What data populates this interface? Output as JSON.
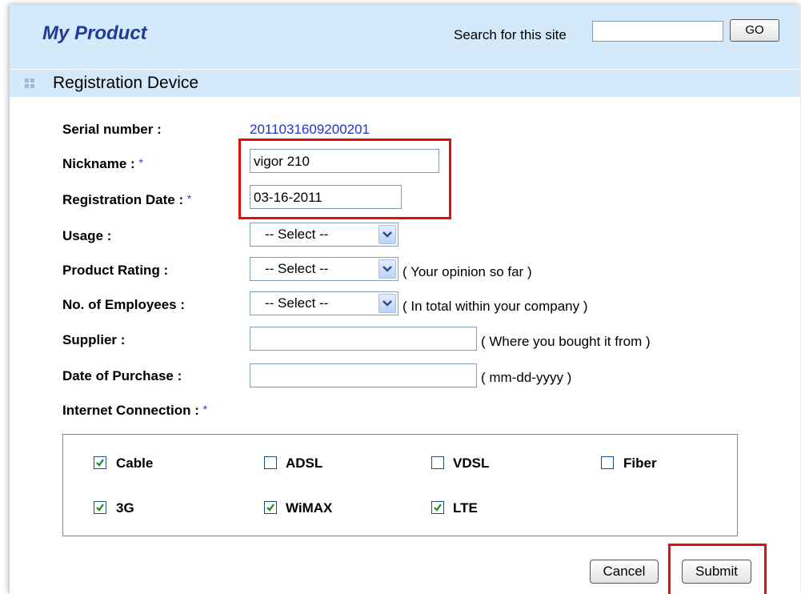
{
  "header": {
    "title": "My Product",
    "search_label": "Search for this site",
    "search_value": "",
    "go_label": "GO"
  },
  "section": {
    "title": "Registration Device"
  },
  "form": {
    "serial": {
      "label": "Serial number :",
      "value": "2011031609200201"
    },
    "nickname": {
      "label": "Nickname :",
      "value": "vigor 210",
      "required": "*"
    },
    "registration_date": {
      "label": "Registration Date :",
      "value": "03-16-2011",
      "required": "*"
    },
    "usage": {
      "label": "Usage :",
      "selected": "-- Select --"
    },
    "product_rating": {
      "label": "Product Rating :",
      "selected": "-- Select --",
      "hint": "( Your opinion so far )"
    },
    "employees": {
      "label": "No. of Employees :",
      "selected": "-- Select --",
      "hint": "( In total within your company )"
    },
    "supplier": {
      "label": "Supplier :",
      "value": "",
      "hint": "( Where you bought it from )"
    },
    "purchase_date": {
      "label": "Date of Purchase :",
      "value": "",
      "hint": "( mm-dd-yyyy )"
    },
    "internet_connection": {
      "label": "Internet Connection :",
      "required": "*",
      "options": [
        {
          "label": "Cable",
          "checked": true
        },
        {
          "label": "ADSL",
          "checked": false
        },
        {
          "label": "VDSL",
          "checked": false
        },
        {
          "label": "Fiber",
          "checked": false
        },
        {
          "label": "3G",
          "checked": true
        },
        {
          "label": "WiMAX",
          "checked": true
        },
        {
          "label": "LTE",
          "checked": true
        }
      ]
    }
  },
  "buttons": {
    "cancel": "Cancel",
    "submit": "Submit"
  },
  "colors": {
    "header_bg": "#d4eafb",
    "brand": "#1f3c93",
    "link": "#2233cc",
    "highlight": "#e01010"
  }
}
